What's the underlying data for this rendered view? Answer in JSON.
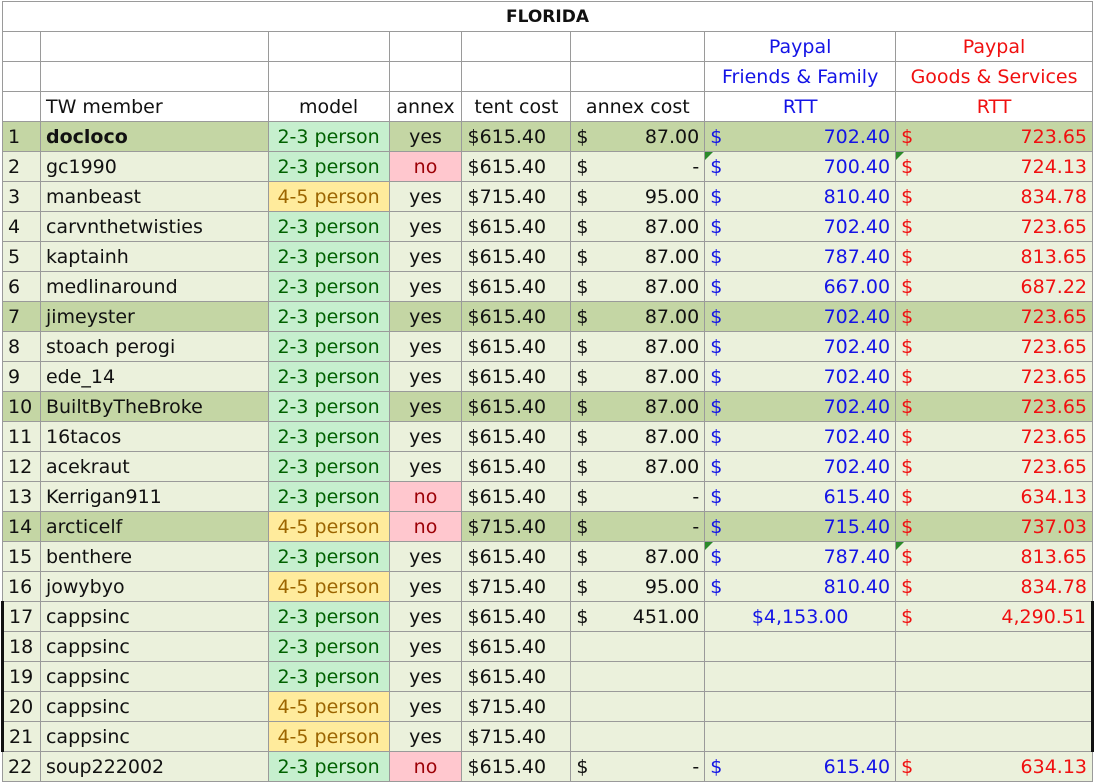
{
  "sheet": {
    "title": "FLORIDA",
    "header_ff": [
      "Paypal",
      "Friends & Family",
      "RTT"
    ],
    "header_gs": [
      "Paypal",
      "Goods & Services",
      "RTT"
    ],
    "columns": [
      "",
      "TW member",
      "model",
      "annex",
      "tent cost",
      "annex cost"
    ],
    "rows": [
      {
        "n": "1",
        "member": "docloco",
        "model": "2-3 person",
        "annex": "yes",
        "tent": "$615.40",
        "annex_cost": "87.00",
        "ff": "702.40",
        "gs": "723.65"
      },
      {
        "n": "2",
        "member": "gc1990",
        "model": "2-3 person",
        "annex": "no",
        "tent": "$615.40",
        "annex_cost": "-",
        "ff": "700.40",
        "gs": "724.13"
      },
      {
        "n": "3",
        "member": "manbeast",
        "model": "4-5 person",
        "annex": "yes",
        "tent": "$715.40",
        "annex_cost": "95.00",
        "ff": "810.40",
        "gs": "834.78"
      },
      {
        "n": "4",
        "member": "carvnthetwisties",
        "model": "2-3 person",
        "annex": "yes",
        "tent": "$615.40",
        "annex_cost": "87.00",
        "ff": "702.40",
        "gs": "723.65"
      },
      {
        "n": "5",
        "member": "kaptainh",
        "model": "2-3 person",
        "annex": "yes",
        "tent": "$615.40",
        "annex_cost": "87.00",
        "ff": "787.40",
        "gs": "813.65"
      },
      {
        "n": "6",
        "member": "medlinaround",
        "model": "2-3 person",
        "annex": "yes",
        "tent": "$615.40",
        "annex_cost": "87.00",
        "ff": "667.00",
        "gs": "687.22"
      },
      {
        "n": "7",
        "member": "jimeyster",
        "model": "2-3 person",
        "annex": "yes",
        "tent": "$615.40",
        "annex_cost": "87.00",
        "ff": "702.40",
        "gs": "723.65"
      },
      {
        "n": "8",
        "member": "stoach perogi",
        "model": "2-3 person",
        "annex": "yes",
        "tent": "$615.40",
        "annex_cost": "87.00",
        "ff": "702.40",
        "gs": "723.65"
      },
      {
        "n": "9",
        "member": "ede_14",
        "model": "2-3 person",
        "annex": "yes",
        "tent": "$615.40",
        "annex_cost": "87.00",
        "ff": "702.40",
        "gs": "723.65"
      },
      {
        "n": "10",
        "member": "BuiltByTheBroke",
        "model": "2-3 person",
        "annex": "yes",
        "tent": "$615.40",
        "annex_cost": "87.00",
        "ff": "702.40",
        "gs": "723.65"
      },
      {
        "n": "11",
        "member": "16tacos",
        "model": "2-3 person",
        "annex": "yes",
        "tent": "$615.40",
        "annex_cost": "87.00",
        "ff": "702.40",
        "gs": "723.65"
      },
      {
        "n": "12",
        "member": "acekraut",
        "model": "2-3 person",
        "annex": "yes",
        "tent": "$615.40",
        "annex_cost": "87.00",
        "ff": "702.40",
        "gs": "723.65"
      },
      {
        "n": "13",
        "member": "Kerrigan911",
        "model": "2-3 person",
        "annex": "no",
        "tent": "$615.40",
        "annex_cost": "-",
        "ff": "615.40",
        "gs": "634.13"
      },
      {
        "n": "14",
        "member": "arcticelf",
        "model": "4-5 person",
        "annex": "no",
        "tent": "$715.40",
        "annex_cost": "-",
        "ff": "715.40",
        "gs": "737.03"
      },
      {
        "n": "15",
        "member": "benthere",
        "model": "2-3 person",
        "annex": "yes",
        "tent": "$615.40",
        "annex_cost": "87.00",
        "ff": "787.40",
        "gs": "813.65"
      },
      {
        "n": "16",
        "member": "jowybyo",
        "model": "4-5 person",
        "annex": "yes",
        "tent": "$715.40",
        "annex_cost": "95.00",
        "ff": "810.40",
        "gs": "834.78"
      },
      {
        "n": "17",
        "member": "cappsinc",
        "model": "2-3 person",
        "annex": "yes",
        "tent": "$615.40",
        "annex_cost": "451.00",
        "ff": "$4,153.00",
        "gs": "4,290.51"
      },
      {
        "n": "18",
        "member": "cappsinc",
        "model": "2-3 person",
        "annex": "yes",
        "tent": "$615.40"
      },
      {
        "n": "19",
        "member": "cappsinc",
        "model": "2-3 person",
        "annex": "yes",
        "tent": "$615.40"
      },
      {
        "n": "20",
        "member": "cappsinc",
        "model": "4-5 person",
        "annex": "yes",
        "tent": "$715.40"
      },
      {
        "n": "21",
        "member": "cappsinc",
        "model": "4-5 person",
        "annex": "yes",
        "tent": "$715.40"
      },
      {
        "n": "22",
        "member": "soup222002",
        "model": "2-3 person",
        "annex": "no",
        "tent": "$615.40",
        "annex_cost": "-",
        "ff": "615.40",
        "gs": "634.13"
      }
    ],
    "highlight_rows": [
      1,
      7,
      10,
      14
    ],
    "bold_rows": [
      1
    ],
    "comment_rows": [
      2,
      15
    ],
    "group_rows": [
      17,
      18,
      19,
      20,
      21
    ],
    "plain_ff_rows": [
      17
    ],
    "colors": {
      "highlight": "#c4d6a4",
      "row_fill": "#ebf1dc",
      "green_fill": "#c6efce",
      "green_text": "#006100",
      "orange_fill": "#ffeb9c",
      "orange_text": "#9c6500",
      "pink_fill": "#ffc7ce",
      "pink_text": "#9c0006",
      "blue_text": "#1414e6",
      "red_text": "#f01010"
    }
  }
}
